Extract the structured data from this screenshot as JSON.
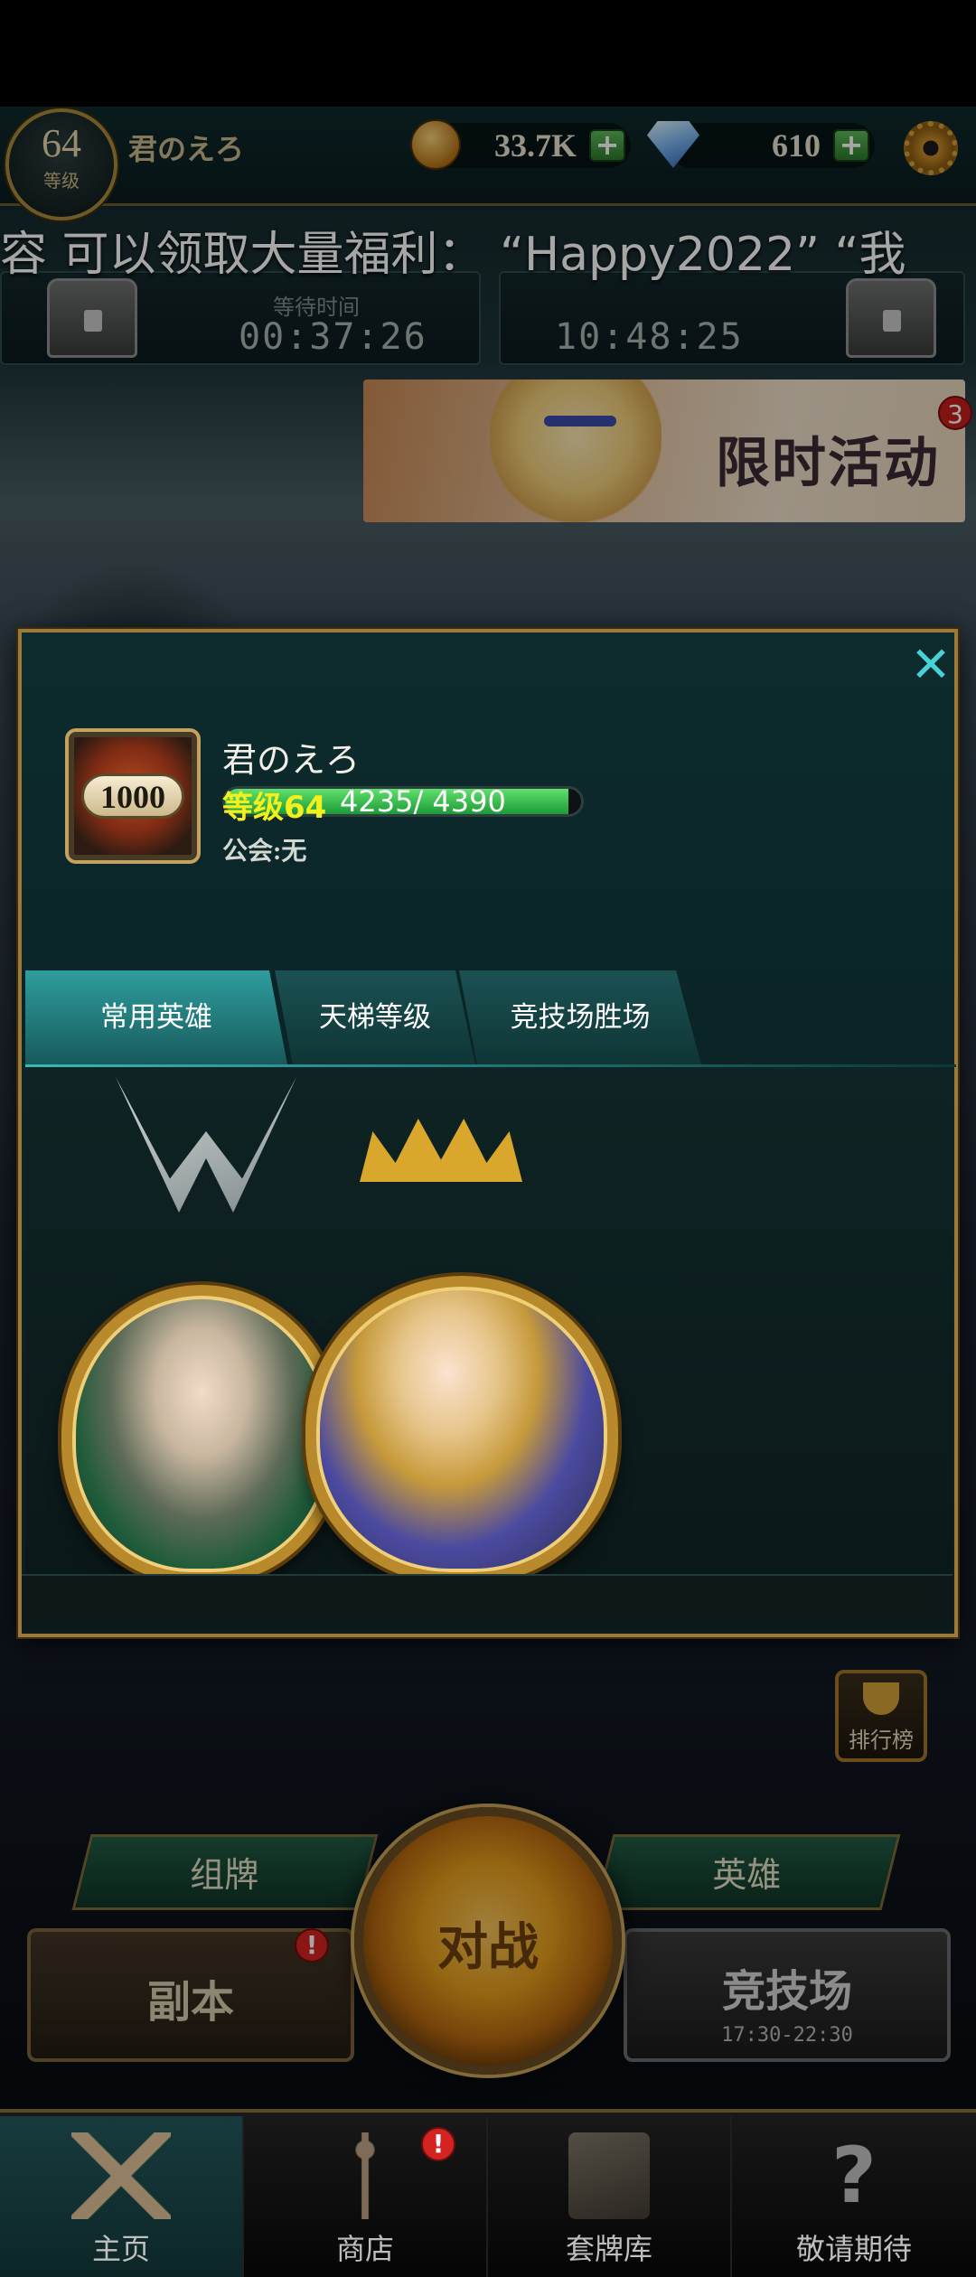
{
  "hud": {
    "level": "64",
    "level_label": "等级",
    "player_name": "君のえろ",
    "coins": "33.7K",
    "gems": "610",
    "plus": "+"
  },
  "ticker": {
    "text": "容 可以领取大量福利： “Happy2022” “我"
  },
  "timers": {
    "wait_label": "等待时间",
    "timer_1": "00:37:26",
    "timer_2": "10:48:25"
  },
  "event": {
    "title": "限时活动",
    "count": "3"
  },
  "profile": {
    "close": "✕",
    "rank_value": "1000",
    "name": "君のえろ",
    "level_text": "等级64",
    "exp_text": "4235/ 4390",
    "exp_current": 4235,
    "exp_max": 4390,
    "guild_text": "公会:无",
    "tabs": [
      {
        "label": "常用英雄"
      },
      {
        "label": "天梯等级"
      },
      {
        "label": "竞技场胜场"
      }
    ]
  },
  "main": {
    "leaderboard_label": "排行榜",
    "deck_label": "组牌",
    "hero_label": "英雄",
    "battle_label": "对战",
    "dungeon_label": "副本",
    "arena_label": "竞技场",
    "arena_time": "17:30-22:30",
    "alert_mark": "!"
  },
  "nav": {
    "items": [
      {
        "label": "主页",
        "icon": "swords-icon"
      },
      {
        "label": "商店",
        "icon": "scales-icon"
      },
      {
        "label": "套牌库",
        "icon": "cards-icon"
      },
      {
        "label": "敬请期待",
        "icon": "question-icon"
      }
    ]
  },
  "colors": {
    "accent_teal": "#46d2d6",
    "gold": "#b88a2b",
    "level_yellow": "#f4f01f",
    "exp_green": "#1c9a37",
    "alert_red": "#d42422"
  }
}
